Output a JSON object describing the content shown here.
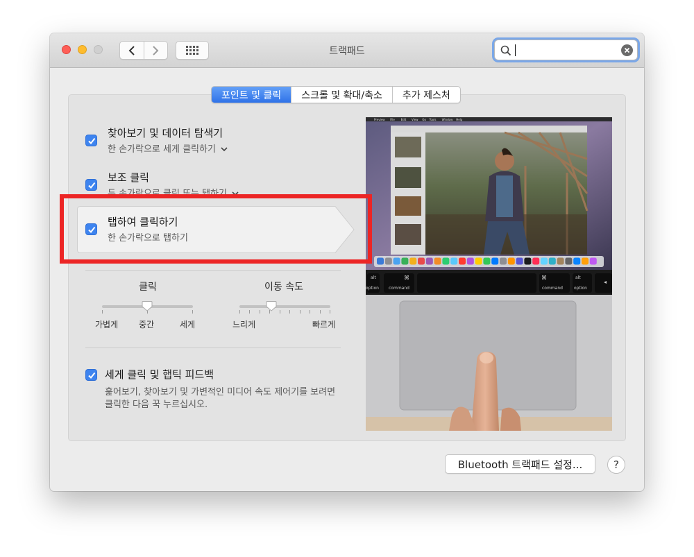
{
  "window": {
    "title": "트랙패드"
  },
  "search": {
    "value": "",
    "placeholder": ""
  },
  "tabs": [
    {
      "label": "포인트 및 클릭",
      "active": true
    },
    {
      "label": "스크롤 및 확대/축소",
      "active": false
    },
    {
      "label": "추가 제스처",
      "active": false
    }
  ],
  "options": {
    "lookup": {
      "title": "찾아보기 및 데이터 탐색기",
      "subtitle": "한 손가락으로 세게 클릭하기",
      "checked": true
    },
    "secondary": {
      "title": "보조 클릭",
      "subtitle": "두 손가락으로 클릭 또는 탭하기",
      "checked": true
    },
    "tap": {
      "title": "탭하여 클릭하기",
      "subtitle": "한 손가락으로 탭하기",
      "checked": true
    },
    "force": {
      "title": "세게 클릭 및 햅틱 피드백",
      "subtitle_line1": "훑어보기, 찾아보기 및 가변적인 미디어 속도 제어기를 보려면",
      "subtitle_line2": "클릭한 다음 꾹 누르십시오.",
      "checked": true
    }
  },
  "sliders": {
    "click": {
      "label": "클릭",
      "min_label": "가볍게",
      "mid_label": "중간",
      "max_label": "세게",
      "value_step": 1,
      "steps": 3
    },
    "tracking": {
      "label": "이동 속도",
      "min_label": "느리게",
      "max_label": "빠르게",
      "value_fraction": 0.35
    }
  },
  "preview": {
    "menu_items": [
      "Preview",
      "File",
      "Edit",
      "View",
      "Go",
      "Tools",
      "Window",
      "Help"
    ],
    "keys": {
      "alt_left": "alt",
      "option_left": "option",
      "cmd_symbol": "⌘",
      "command": "command",
      "alt_right": "alt",
      "option_right": "option"
    }
  },
  "buttons": {
    "bluetooth": "Bluetooth 트랙패드 설정...",
    "help": "?"
  },
  "colors": {
    "accent": "#3e84ef",
    "highlight_box": "#ec2525"
  }
}
